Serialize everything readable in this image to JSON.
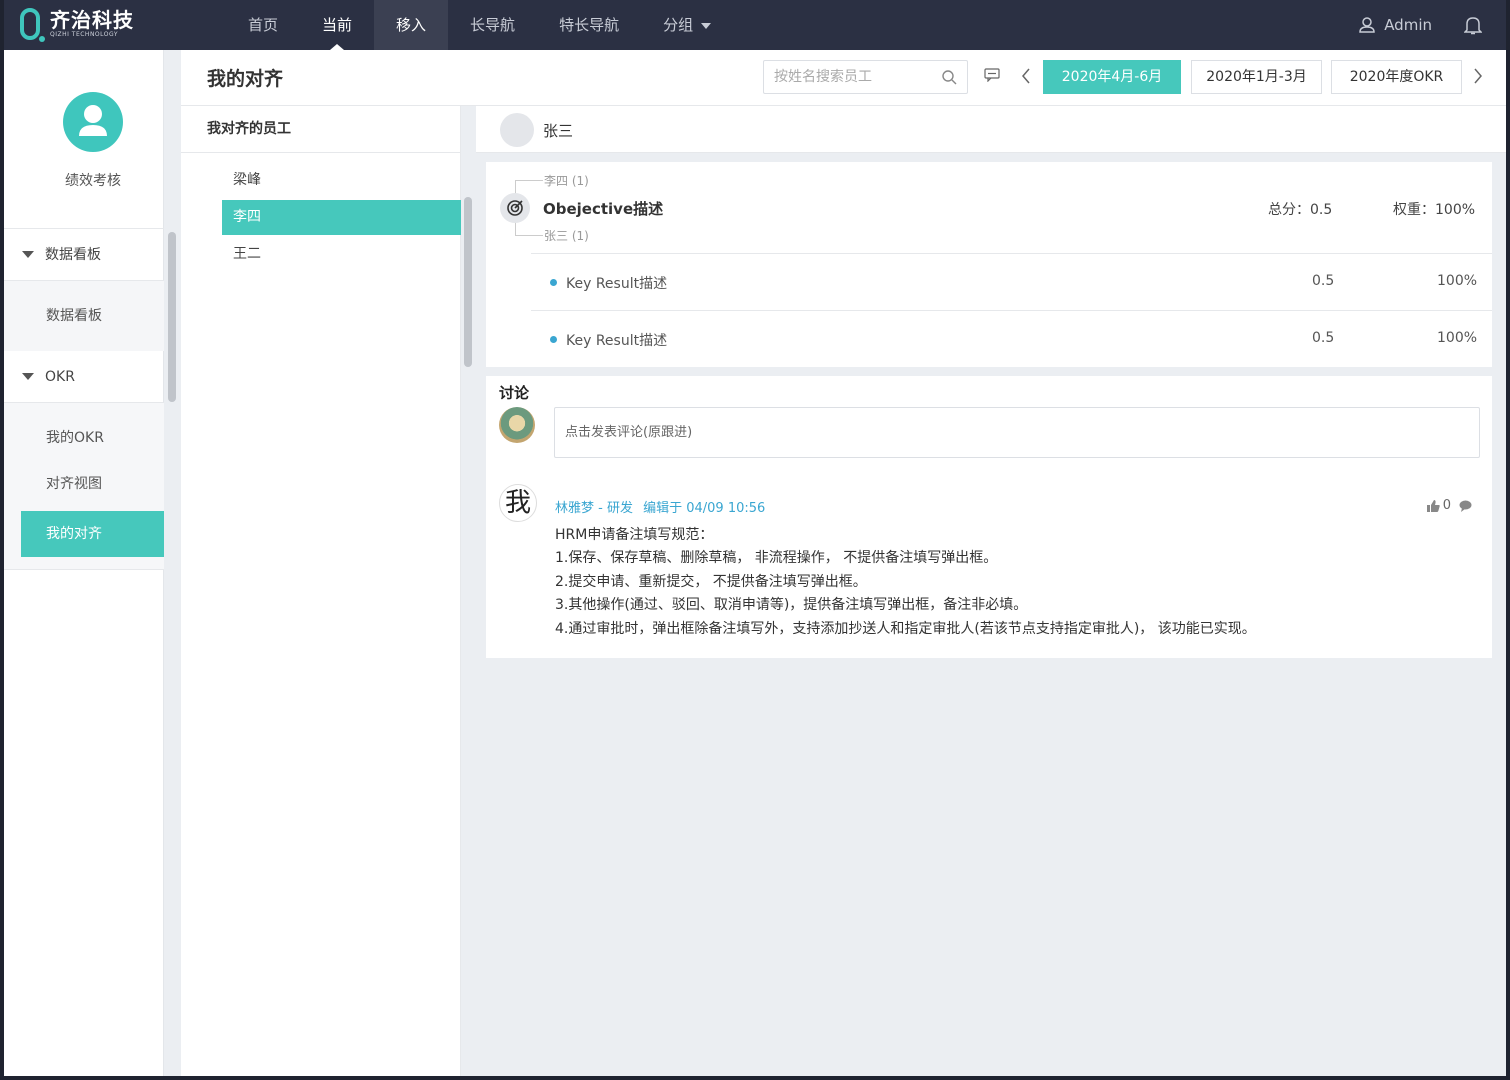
{
  "brand": {
    "name_cn": "齐治科技",
    "name_en": "QIZHI TECHNOLOGY",
    "color": "#3fc6bd"
  },
  "nav": {
    "items": [
      "首页",
      "当前",
      "移入",
      "长导航",
      "特长导航",
      "分组"
    ],
    "current_index": 1,
    "hover_index": 2
  },
  "user": {
    "name": "Admin"
  },
  "sidebar": {
    "title": "绩效考核",
    "groups": [
      {
        "label": "数据看板",
        "items": [
          "数据看板"
        ]
      },
      {
        "label": "OKR",
        "items": [
          "我的OKR",
          "对齐视图",
          "我的对齐"
        ]
      }
    ],
    "active_item": "我的对齐"
  },
  "header": {
    "title": "我的对齐",
    "search_placeholder": "按姓名搜索员工",
    "periods": [
      "2020年4月-6月",
      "2020年1月-3月",
      "2020年度OKR"
    ],
    "active_period": "2020年4月-6月"
  },
  "employees": {
    "heading": "我对齐的员工",
    "items": [
      "梁峰",
      "李四",
      "王二"
    ],
    "active": "李四"
  },
  "detail": {
    "name": "张三",
    "objective": {
      "parent_label": "李四 (1)",
      "child_label": "张三 (1)",
      "title": "Obejective描述",
      "score_label": "总分：0.5",
      "weight_label": "权重：100%"
    },
    "key_results": [
      {
        "label": "Key  Result描述",
        "score": "0.5",
        "weight": "100%"
      },
      {
        "label": "Key  Result描述",
        "score": "0.5",
        "weight": "100%"
      }
    ]
  },
  "discussion": {
    "title": "讨论",
    "input_placeholder": "点击发表评论(原跟进)",
    "comment": {
      "author": "林雅梦 - 研发",
      "edited": "编辑于 04/09 10:56",
      "likes": "0",
      "avatar_char": "我",
      "lines": [
        "HRM申请备注填写规范：",
        "1.保存、保存草稿、删除草稿，  非流程操作，  不提供备注填写弹出框。",
        "2.提交申请、重新提交，  不提供备注填写弹出框。",
        "3.其他操作(通过、驳回、取消申请等)，提供备注填写弹出框，备注非必填。",
        "4.通过审批时，弹出框除备注填写外，支持添加抄送人和指定审批人(若该节点支持指定审批人)，  该功能已实现。"
      ]
    }
  },
  "colors": {
    "accent": "#46c8bc",
    "nav_bg": "#2b3043",
    "link": "#3aa6d1"
  }
}
